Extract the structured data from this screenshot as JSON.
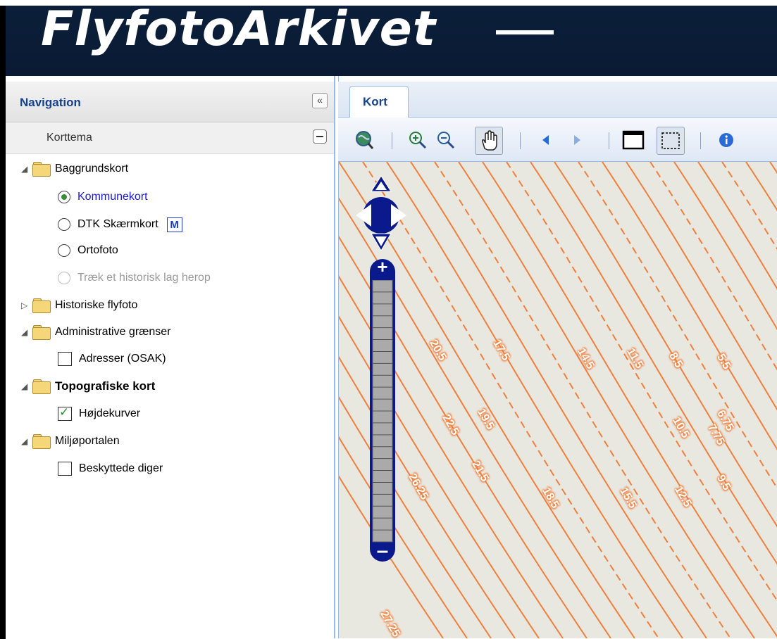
{
  "app": {
    "title": "FlyfotoArkivet"
  },
  "navigation": {
    "title": "Navigation",
    "collapse_glyph": "«",
    "section_title": "Korttema",
    "tree": {
      "baggrund": {
        "label": "Baggrundskort",
        "options": [
          {
            "label": "Kommunekort",
            "selected": true,
            "enabled": true
          },
          {
            "label": "DTK Skærmkort",
            "selected": false,
            "enabled": true,
            "badge": "M"
          },
          {
            "label": "Ortofoto",
            "selected": false,
            "enabled": true
          },
          {
            "label": "Træk et historisk lag herop",
            "selected": false,
            "enabled": false
          }
        ]
      },
      "historiske": {
        "label": "Historiske flyfoto"
      },
      "admin": {
        "label": "Administrative grænser",
        "layers": [
          {
            "label": "Adresser (OSAK)",
            "checked": false
          }
        ]
      },
      "topo": {
        "label": "Topografiske kort",
        "layers": [
          {
            "label": "Højdekurver",
            "checked": true
          }
        ]
      },
      "miljo": {
        "label": "Miljøportalen",
        "layers": [
          {
            "label": "Beskyttede diger",
            "checked": false
          }
        ]
      }
    }
  },
  "map_panel": {
    "tab_label": "Kort",
    "toolbar": [
      "globe-icon",
      "zoom-in-icon",
      "zoom-out-icon",
      "pan-hand-icon",
      "back-arrow-icon",
      "forward-arrow-icon",
      "full-extent-icon",
      "box-select-icon",
      "info-icon"
    ],
    "zoom_levels": 22,
    "contour_labels": [
      "20.5",
      "17.5",
      "14.5",
      "11.5",
      "8.5",
      "5.5",
      "22.5",
      "19.5",
      "10.5",
      "7.75",
      "6.75",
      "26.25",
      "21.5",
      "18.5",
      "15.5",
      "12.5",
      "9.5",
      "27.25"
    ]
  },
  "colors": {
    "contour": "#ef7f3c",
    "header": "#0b1f3a",
    "nav_blue": "#15428b",
    "map_bg": "#e9e8e0"
  }
}
